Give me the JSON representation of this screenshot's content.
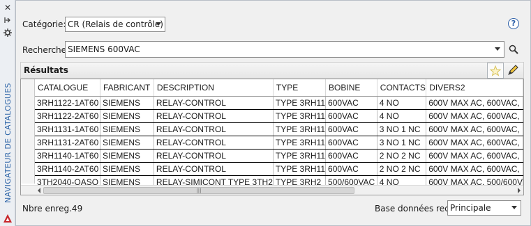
{
  "panel": {
    "vertical_title": "NAVIGATEUR DE CATALOGUES"
  },
  "category": {
    "label": "Catégorie:",
    "value": "CR (Relais de contrôle)"
  },
  "search": {
    "label": "Rechercher:",
    "value": "SIEMENS 600VAC"
  },
  "help": {
    "label": "?"
  },
  "results": {
    "title": "Résultats",
    "columns": [
      "CATALOGUE",
      "FABRICANT",
      "DESCRIPTION",
      "TYPE",
      "BOBINE",
      "CONTACTS",
      "DIVERS2"
    ],
    "rows": [
      [
        "3RH1122-1AT60",
        "SIEMENS",
        "RELAY-CONTROL",
        "TYPE 3RH11",
        "600VAC",
        "4 NO",
        "600V MAX AC, 600VAC,"
      ],
      [
        "3RH1122-2AT60",
        "SIEMENS",
        "RELAY-CONTROL",
        "TYPE 3RH11",
        "600VAC",
        "4 NO",
        "600V MAX AC, 600VAC,"
      ],
      [
        "3RH1131-1AT60",
        "SIEMENS",
        "RELAY-CONTROL",
        "TYPE 3RH11",
        "600VAC",
        "3 NO 1 NC",
        "600V MAX AC, 600VAC,"
      ],
      [
        "3RH1131-2AT60",
        "SIEMENS",
        "RELAY-CONTROL",
        "TYPE 3RH11",
        "600VAC",
        "3 NO 1 NC",
        "600V MAX AC, 600VAC,"
      ],
      [
        "3RH1140-1AT60",
        "SIEMENS",
        "RELAY-CONTROL",
        "TYPE 3RH11",
        "600VAC",
        "2 NO 2 NC",
        "600V MAX AC, 600VAC,"
      ],
      [
        "3RH1140-2AT60",
        "SIEMENS",
        "RELAY-CONTROL",
        "TYPE 3RH11",
        "600VAC",
        "2 NO 2 NC",
        "600V MAX AC, 600VAC,"
      ],
      [
        "3TH2040-OASO",
        "SIEMENS",
        "RELAY-SIMICONT TYPE 3TH2",
        "TYPE 3RH2",
        "500/600VAC",
        "4 NO",
        "600V MAX AC, 500/600V"
      ]
    ],
    "sorted_column": "CATALOGUE"
  },
  "footer": {
    "record_count": "Nbre enreg.49",
    "db_label": "Base données rech.:",
    "db_value": "Principale"
  },
  "colors": {
    "accent": "#2f66a8",
    "grid_border": "#9a9a9a"
  },
  "icons": [
    "close-icon",
    "pin-icon",
    "settings-icon",
    "help-icon",
    "search-icon",
    "favorite-star-icon",
    "edit-pencil-icon",
    "autodesk-logo-icon"
  ]
}
